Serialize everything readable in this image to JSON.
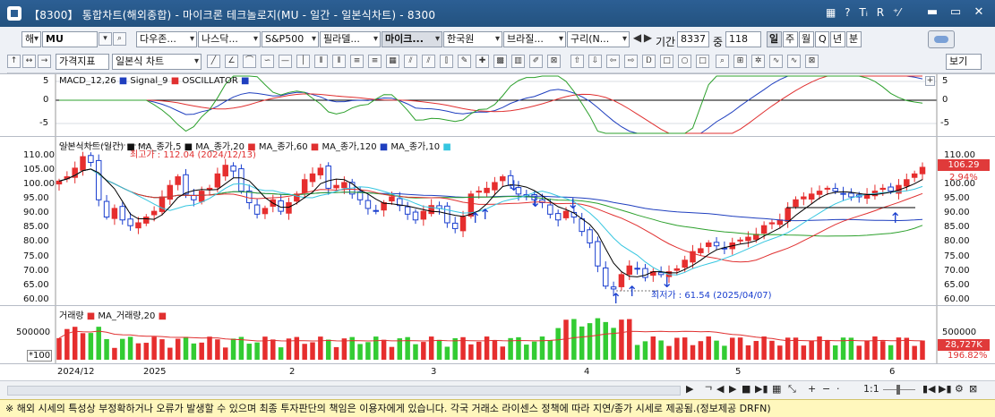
{
  "window": {
    "title": "【8300】 통합차트(해외종합) - 마이크론 테크놀로지(MU - 일간 - 일본식차트) - 8300",
    "header_icons": [
      "?",
      "Tᵢ",
      "R",
      "⁺⁄"
    ]
  },
  "toolbar1": {
    "market": "해",
    "symbol": "MU",
    "tabs": [
      "다우존...",
      "나스닥...",
      "S&P500",
      "필라델...",
      "마이크...",
      "한국원",
      "브라질...",
      "구리(N..."
    ],
    "selected_tab": "마이크...",
    "period_label": "기간",
    "period_value": "8337",
    "count_label": "중",
    "count_value": "118",
    "interval_tabs": [
      "일",
      "주",
      "월",
      "Q",
      "년",
      "분"
    ],
    "selected_interval": "일"
  },
  "toolbar2": {
    "indicator_label": "가격지표",
    "chart_type": "일본식 차트",
    "view_label": "보기"
  },
  "macd": {
    "legend": [
      "MACD_12,26",
      "Signal_9",
      "OSCILLATOR"
    ],
    "legend_colors": [
      "#1f3fbf",
      "#e03030",
      "#2ca02c"
    ],
    "ticks_left": [
      "5",
      "0",
      "-5"
    ],
    "ticks_right": [
      "5",
      "0",
      "-5"
    ]
  },
  "price": {
    "legend": [
      "일본식차트(일간)",
      "MA_종가,5",
      "MA_종가,20",
      "MA_종가,60",
      "MA_종가,120",
      "MA_종가,10"
    ],
    "legend_colors": [
      "#000000",
      "#000000",
      "#e03030",
      "#2ca02c",
      "#1f3fbf",
      "#36c6e0"
    ],
    "high_label": "최고가 : 112.04 (2024/12/13)",
    "low_label": "최저가 : 61.54 (2025/04/07)",
    "ticks": [
      "110.00",
      "105.00",
      "100.00",
      "95.00",
      "90.00",
      "85.00",
      "80.00",
      "75.00",
      "70.00",
      "65.00",
      "60.00"
    ],
    "rticks": [
      "110.00",
      "100.00",
      "95.00",
      "90.00",
      "85.00",
      "80.00",
      "75.00",
      "70.00",
      "65.00",
      "60.00"
    ],
    "last_price": "106.29",
    "change_pct": "2.94%",
    "colors": {
      "up": "#e62e2e",
      "down": "#1a3fcf"
    }
  },
  "volume": {
    "legend": [
      "거래량",
      "MA_거래량,20"
    ],
    "tick": "500000",
    "unit": "*100",
    "last_volume": "28,727K",
    "volume_pct": "196.82%",
    "rtick": "500000"
  },
  "xaxis": {
    "labels": [
      "2024/12",
      "2025",
      "2",
      "3",
      "4",
      "5",
      "6"
    ]
  },
  "navbar": {
    "zoom": "1:1"
  },
  "status": {
    "text": "※ 해외 시세의 특성상 부정확하거나 오류가 발생할 수 있으며 최종 투자판단의 책임은 이용자에게 있습니다. 각국 거래소 라이센스 정책에 따라 지연/종가 시세로 제공됨.(정보제공 DRFN)"
  },
  "chart_data": {
    "type": "candlestick",
    "x_axis": [
      "2024/12",
      "2025",
      "2",
      "3",
      "4",
      "5",
      "6"
    ],
    "y_range": [
      60,
      112
    ],
    "high": {
      "value": 112.04,
      "date": "2024/12/13"
    },
    "low": {
      "value": 61.54,
      "date": "2025/04/07"
    },
    "last_close": 106.29,
    "change_pct": 2.94,
    "closes": [
      101.5,
      103,
      106,
      110,
      108,
      95,
      89,
      92,
      88,
      86,
      87,
      89,
      91,
      96,
      100,
      103,
      97,
      95,
      98,
      99,
      104,
      107,
      105,
      98,
      94,
      90,
      92,
      95,
      91,
      94,
      97,
      102,
      104,
      106,
      99,
      100,
      101,
      97,
      95,
      92,
      91,
      94,
      96,
      93,
      90,
      88,
      91,
      93,
      92,
      87,
      85,
      89,
      97,
      98,
      99,
      101,
      103,
      100,
      97,
      96,
      95,
      94,
      90,
      88,
      91,
      89,
      84,
      80,
      72,
      65,
      64,
      69,
      72,
      71,
      68,
      70,
      69,
      70,
      71,
      74,
      77,
      78,
      80,
      79,
      78,
      80,
      81,
      82,
      83,
      86,
      87,
      88,
      92,
      95,
      96,
      97,
      98,
      99,
      98,
      97,
      96,
      96,
      97,
      98,
      99,
      98,
      100,
      102,
      104,
      106.29
    ],
    "ma_series": [
      "MA_종가,5",
      "MA_종가,20",
      "MA_종가,60",
      "MA_종가,120",
      "MA_종가,10"
    ]
  }
}
